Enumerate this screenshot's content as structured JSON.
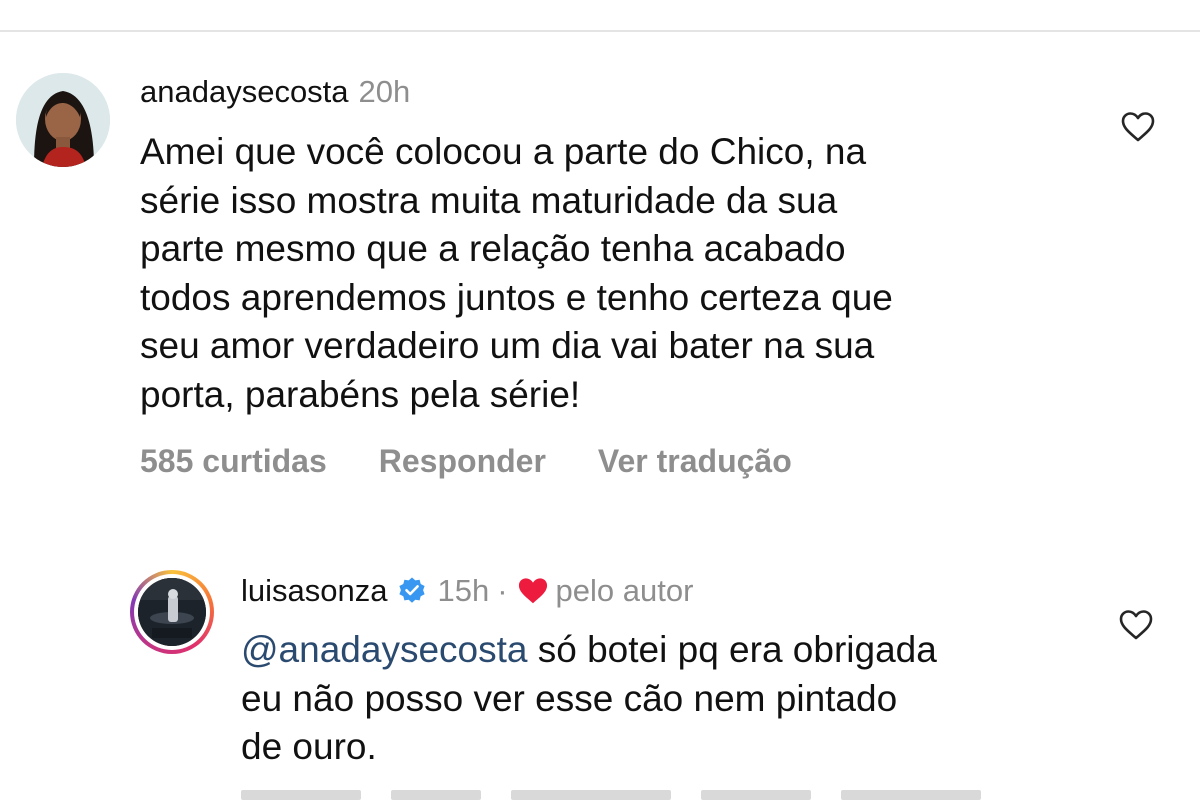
{
  "comments": [
    {
      "username": "anadaysecosta",
      "time": "20h",
      "text_lines": [
        "Amei que você colocou a parte do Chico, na",
        "série isso mostra muita maturidade da sua",
        "parte mesmo que a relação tenha acabado",
        "todos aprendemos juntos e tenho certeza que",
        "seu amor verdadeiro um dia vai bater na sua",
        "porta, parabéns pela série!"
      ],
      "likes": "585 curtidas",
      "reply_label": "Responder",
      "translate_label": "Ver tradução"
    },
    {
      "username": "luisasonza",
      "verified": true,
      "time": "15h",
      "separator": "·",
      "liked_by_author_label": "pelo autor",
      "mention": "@anadaysecosta",
      "text_first_rest": " só botei pq era obrigada",
      "text_lines": [
        "eu não posso ver esse cão nem pintado",
        "de ouro."
      ]
    }
  ],
  "icons": {
    "like": "heart-outline-icon",
    "liked_by_author": "heart-filled-icon",
    "verified": "verified-badge-icon"
  },
  "colors": {
    "text": "#111111",
    "secondary": "#8e8e8e",
    "mention": "#2b4a6f",
    "heart_red": "#ed1c3f",
    "verified_blue": "#3897f0"
  }
}
